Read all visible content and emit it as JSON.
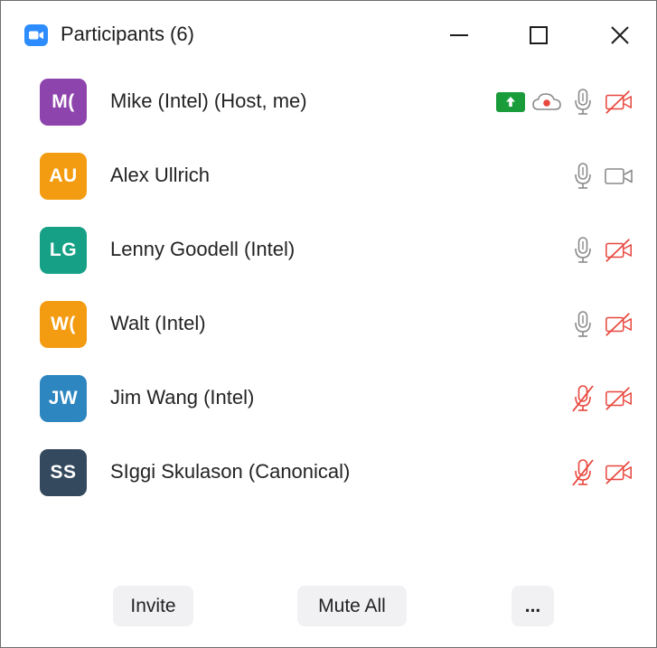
{
  "window": {
    "title": "Participants (6)"
  },
  "participants": [
    {
      "initials": "M(",
      "name": "Mike (Intel) (Host, me)",
      "avatar_color": "#8e44ad",
      "sharing": true,
      "recording": true,
      "mic": "on",
      "video": "off"
    },
    {
      "initials": "AU",
      "name": "Alex Ullrich",
      "avatar_color": "#f39c12",
      "sharing": false,
      "recording": false,
      "mic": "on",
      "video": "on"
    },
    {
      "initials": "LG",
      "name": "Lenny Goodell (Intel)",
      "avatar_color": "#16a085",
      "sharing": false,
      "recording": false,
      "mic": "on",
      "video": "off"
    },
    {
      "initials": "W(",
      "name": "Walt (Intel)",
      "avatar_color": "#f39c12",
      "sharing": false,
      "recording": false,
      "mic": "on",
      "video": "off"
    },
    {
      "initials": "JW",
      "name": "Jim Wang (Intel)",
      "avatar_color": "#2e86c1",
      "sharing": false,
      "recording": false,
      "mic": "off",
      "video": "off"
    },
    {
      "initials": "SS",
      "name": "SIggi Skulason (Canonical)",
      "avatar_color": "#34495e",
      "sharing": false,
      "recording": false,
      "mic": "off",
      "video": "off"
    }
  ],
  "footer": {
    "invite_label": "Invite",
    "mute_all_label": "Mute All",
    "more_label": "..."
  },
  "colors": {
    "muted_red": "#e8473d",
    "icon_gray": "#8a8a8a",
    "share_green": "#1a9c3a",
    "zoom_blue": "#2d8cff"
  }
}
